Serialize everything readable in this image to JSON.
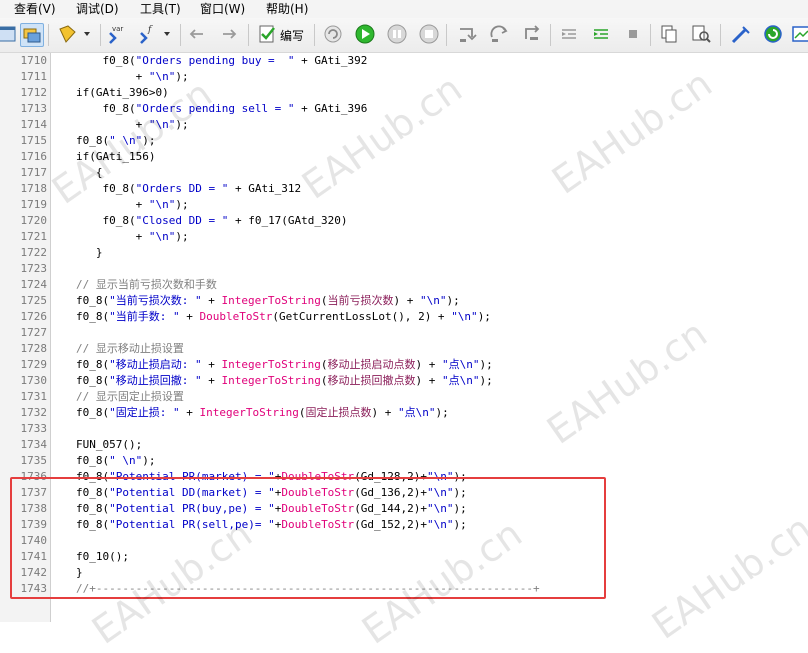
{
  "menus": [
    "查看(V)",
    "调试(D)",
    "工具(T)",
    "窗口(W)",
    "帮助(H)"
  ],
  "toolbar": {
    "compile_label": "编写"
  },
  "icons": [
    "layout-icon",
    "layers-icon",
    "bookmark-icon",
    "variable-icon",
    "function-icon",
    "back-arrow-icon",
    "forward-arrow-icon",
    "compile-icon",
    "undo-circle-icon",
    "run-icon",
    "pause-icon",
    "stop-icon",
    "step-into-icon",
    "step-over-icon",
    "step-out-icon",
    "outdent-icon",
    "indent-icon",
    "small-stop-icon",
    "copy-icon",
    "find-icon",
    "tools-icon",
    "refresh-icon",
    "window-icon"
  ],
  "watermark": "EAHub.cn",
  "highlight_color": "#e53e3e",
  "code": [
    {
      "n": "1710",
      "t": [
        [
          "    f0_8(",
          "plain"
        ],
        [
          "\"Orders pending buy =  \"",
          "string"
        ],
        [
          " + GAti_392",
          "plain"
        ]
      ]
    },
    {
      "n": "1711",
      "t": [
        [
          "         + ",
          "plain"
        ],
        [
          "\"\\n\"",
          "string"
        ],
        [
          ");",
          "plain"
        ]
      ]
    },
    {
      "n": "1712",
      "t": [
        [
          "if",
          "kw"
        ],
        [
          "(GAti_396>",
          "plain"
        ],
        [
          "0",
          "num"
        ],
        [
          ")",
          "plain"
        ]
      ]
    },
    {
      "n": "1713",
      "t": [
        [
          "    f0_8(",
          "plain"
        ],
        [
          "\"Orders pending sell = \"",
          "string"
        ],
        [
          " + GAti_396",
          "plain"
        ]
      ]
    },
    {
      "n": "1714",
      "t": [
        [
          "         + ",
          "plain"
        ],
        [
          "\"\\n\"",
          "string"
        ],
        [
          ");",
          "plain"
        ]
      ]
    },
    {
      "n": "1715",
      "t": [
        [
          "f0_8(",
          "plain"
        ],
        [
          "\" \\n\"",
          "string"
        ],
        [
          ");",
          "plain"
        ]
      ]
    },
    {
      "n": "1716",
      "t": [
        [
          "if",
          "kw"
        ],
        [
          "(GAti_156)",
          "plain"
        ]
      ]
    },
    {
      "n": "1717",
      "t": [
        [
          "   {",
          "plain"
        ]
      ]
    },
    {
      "n": "1718",
      "t": [
        [
          "    f0_8(",
          "plain"
        ],
        [
          "\"Orders DD = \"",
          "string"
        ],
        [
          " + GAti_312",
          "plain"
        ]
      ]
    },
    {
      "n": "1719",
      "t": [
        [
          "         + ",
          "plain"
        ],
        [
          "\"\\n\"",
          "string"
        ],
        [
          ");",
          "plain"
        ]
      ]
    },
    {
      "n": "1720",
      "t": [
        [
          "    f0_8(",
          "plain"
        ],
        [
          "\"Closed DD = \"",
          "string"
        ],
        [
          " + f0_17(GAtd_320)",
          "plain"
        ]
      ]
    },
    {
      "n": "1721",
      "t": [
        [
          "         + ",
          "plain"
        ],
        [
          "\"\\n\"",
          "string"
        ],
        [
          ");",
          "plain"
        ]
      ]
    },
    {
      "n": "1722",
      "t": [
        [
          "   }",
          "plain"
        ]
      ]
    },
    {
      "n": "1723",
      "t": []
    },
    {
      "n": "1724",
      "t": [
        [
          "// 显示当前亏损次数和手数",
          "comment"
        ]
      ]
    },
    {
      "n": "1725",
      "t": [
        [
          "f0_8(",
          "plain"
        ],
        [
          "\"当前亏损次数: \"",
          "string"
        ],
        [
          " + ",
          "plain"
        ],
        [
          "IntegerToString",
          "func"
        ],
        [
          "(",
          "plain"
        ],
        [
          "当前亏损次数",
          "zh"
        ],
        [
          ") + ",
          "plain"
        ],
        [
          "\"\\n\"",
          "string"
        ],
        [
          ");",
          "plain"
        ]
      ]
    },
    {
      "n": "1726",
      "t": [
        [
          "f0_8(",
          "plain"
        ],
        [
          "\"当前手数: \"",
          "string"
        ],
        [
          " + ",
          "plain"
        ],
        [
          "DoubleToStr",
          "func"
        ],
        [
          "(GetCurrentLossLot(), ",
          "plain"
        ],
        [
          "2",
          "num"
        ],
        [
          ") + ",
          "plain"
        ],
        [
          "\"\\n\"",
          "string"
        ],
        [
          ");",
          "plain"
        ]
      ]
    },
    {
      "n": "1727",
      "t": []
    },
    {
      "n": "1728",
      "t": [
        [
          "// 显示移动止损设置",
          "comment"
        ]
      ]
    },
    {
      "n": "1729",
      "t": [
        [
          "f0_8(",
          "plain"
        ],
        [
          "\"移动止损启动: \"",
          "string"
        ],
        [
          " + ",
          "plain"
        ],
        [
          "IntegerToString",
          "func"
        ],
        [
          "(",
          "plain"
        ],
        [
          "移动止损启动点数",
          "zh"
        ],
        [
          ") + ",
          "plain"
        ],
        [
          "\"点\\n\"",
          "string"
        ],
        [
          ");",
          "plain"
        ]
      ]
    },
    {
      "n": "1730",
      "t": [
        [
          "f0_8(",
          "plain"
        ],
        [
          "\"移动止损回撤: \"",
          "string"
        ],
        [
          " + ",
          "plain"
        ],
        [
          "IntegerToString",
          "func"
        ],
        [
          "(",
          "plain"
        ],
        [
          "移动止损回撤点数",
          "zh"
        ],
        [
          ") + ",
          "plain"
        ],
        [
          "\"点\\n\"",
          "string"
        ],
        [
          ");",
          "plain"
        ]
      ]
    },
    {
      "n": "1731",
      "t": [
        [
          "// 显示固定止损设置",
          "comment"
        ]
      ]
    },
    {
      "n": "1732",
      "t": [
        [
          "f0_8(",
          "plain"
        ],
        [
          "\"固定止损: \"",
          "string"
        ],
        [
          " + ",
          "plain"
        ],
        [
          "IntegerToString",
          "func"
        ],
        [
          "(",
          "plain"
        ],
        [
          "固定止损点数",
          "zh"
        ],
        [
          ") + ",
          "plain"
        ],
        [
          "\"点\\n\"",
          "string"
        ],
        [
          ");",
          "plain"
        ]
      ]
    },
    {
      "n": "1733",
      "t": []
    },
    {
      "n": "1734",
      "t": [
        [
          "FUN_057();",
          "plain"
        ]
      ]
    },
    {
      "n": "1735",
      "t": [
        [
          "f0_8(",
          "plain"
        ],
        [
          "\" \\n\"",
          "string"
        ],
        [
          ");",
          "plain"
        ]
      ]
    },
    {
      "n": "1736",
      "t": [
        [
          "f0_8(",
          "plain"
        ],
        [
          "\"Potential PR(market) = \"",
          "string"
        ],
        [
          "+",
          "plain"
        ],
        [
          "DoubleToStr",
          "func"
        ],
        [
          "(Gd_128,",
          "plain"
        ],
        [
          "2",
          "num"
        ],
        [
          ")+",
          "plain"
        ],
        [
          "\"\\n\"",
          "string"
        ],
        [
          ");",
          "plain"
        ]
      ]
    },
    {
      "n": "1737",
      "t": [
        [
          "f0_8(",
          "plain"
        ],
        [
          "\"Potential DD(market) = \"",
          "string"
        ],
        [
          "+",
          "plain"
        ],
        [
          "DoubleToStr",
          "func"
        ],
        [
          "(Gd_136,",
          "plain"
        ],
        [
          "2",
          "num"
        ],
        [
          ")+",
          "plain"
        ],
        [
          "\"\\n\"",
          "string"
        ],
        [
          ");",
          "plain"
        ]
      ]
    },
    {
      "n": "1738",
      "t": [
        [
          "f0_8(",
          "plain"
        ],
        [
          "\"Potential PR(buy,pe) = \"",
          "string"
        ],
        [
          "+",
          "plain"
        ],
        [
          "DoubleToStr",
          "func"
        ],
        [
          "(Gd_144,",
          "plain"
        ],
        [
          "2",
          "num"
        ],
        [
          ")+",
          "plain"
        ],
        [
          "\"\\n\"",
          "string"
        ],
        [
          ");",
          "plain"
        ]
      ]
    },
    {
      "n": "1739",
      "t": [
        [
          "f0_8(",
          "plain"
        ],
        [
          "\"Potential PR(sell,pe)= \"",
          "string"
        ],
        [
          "+",
          "plain"
        ],
        [
          "DoubleToStr",
          "func"
        ],
        [
          "(Gd_152,",
          "plain"
        ],
        [
          "2",
          "num"
        ],
        [
          ")+",
          "plain"
        ],
        [
          "\"\\n\"",
          "string"
        ],
        [
          ");",
          "plain"
        ]
      ]
    },
    {
      "n": "1740",
      "t": []
    },
    {
      "n": "1741",
      "t": [
        [
          "f0_10();",
          "plain"
        ]
      ]
    },
    {
      "n": "1742",
      "t": [
        [
          "}",
          "plain"
        ]
      ]
    },
    {
      "n": "1743",
      "t": [
        [
          "//+------------------------------------------------------------------+",
          "comment"
        ]
      ]
    }
  ]
}
